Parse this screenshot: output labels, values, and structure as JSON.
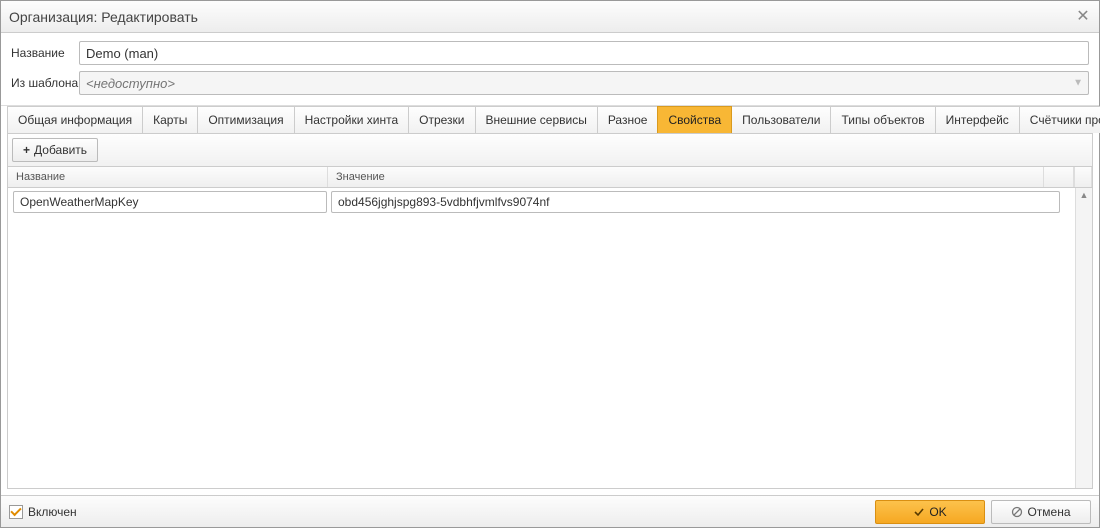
{
  "window": {
    "title": "Организация: Редактировать"
  },
  "form": {
    "name_label": "Название",
    "name_value": "Demo (man)",
    "template_label": "Из шаблона",
    "template_placeholder": "<недоступно>"
  },
  "tabs": [
    {
      "label": "Общая информация"
    },
    {
      "label": "Карты"
    },
    {
      "label": "Оптимизация"
    },
    {
      "label": "Настройки хинта"
    },
    {
      "label": "Отрезки"
    },
    {
      "label": "Внешние сервисы"
    },
    {
      "label": "Разное"
    },
    {
      "label": "Свойства",
      "active": true
    },
    {
      "label": "Пользователи"
    },
    {
      "label": "Типы объектов"
    },
    {
      "label": "Интерфейс"
    },
    {
      "label": "Счётчики пробега и моточасов"
    }
  ],
  "toolbar": {
    "add_label": "Добавить"
  },
  "grid": {
    "columns": {
      "name": "Название",
      "value": "Значение"
    },
    "rows": [
      {
        "name": "OpenWeatherMapKey",
        "value": "obd456jghjspg893-5vdbhfjvmlfvs9074nf"
      }
    ]
  },
  "footer": {
    "enabled_label": "Включен",
    "enabled_checked": true,
    "ok_label": "OK",
    "cancel_label": "Отмена"
  }
}
